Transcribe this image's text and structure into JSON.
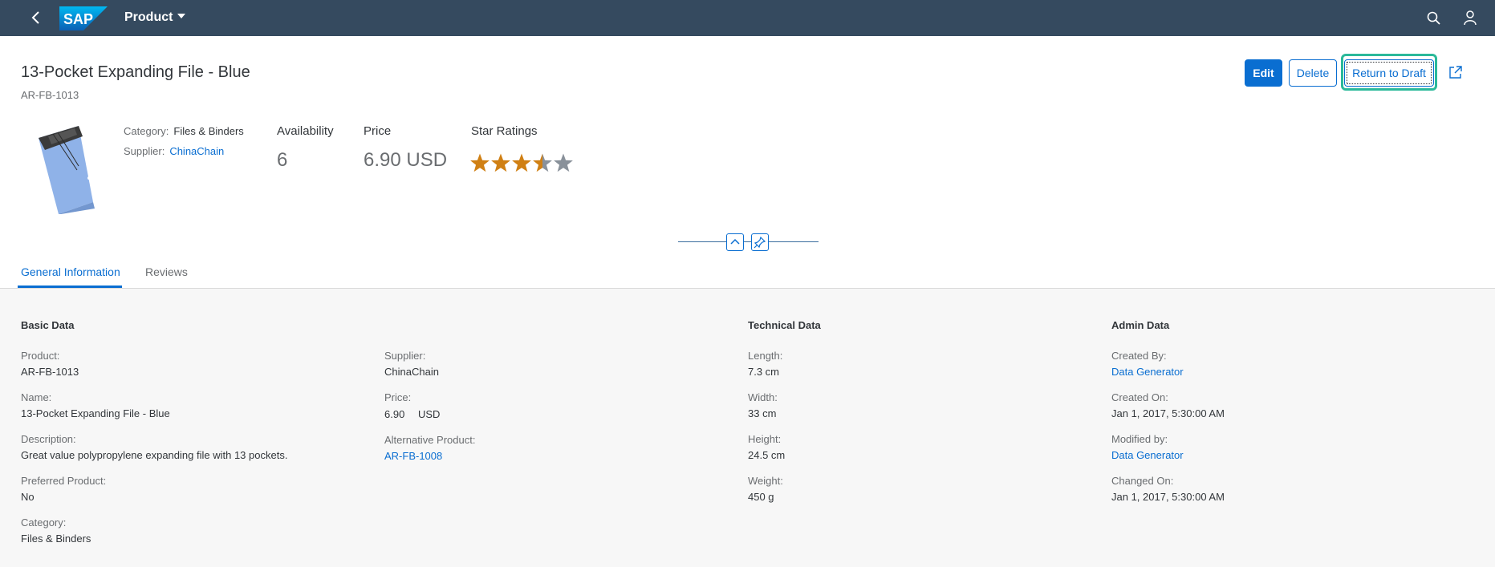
{
  "shell": {
    "app_title": "Product",
    "logo_text": "SAP",
    "colors": {
      "shell_bg": "#354a5f",
      "accent": "#0a6ed1",
      "highlight": "#2bb99a"
    }
  },
  "header": {
    "title": "13-Pocket Expanding File - Blue",
    "subtitle": "AR-FB-1013",
    "actions": {
      "edit": "Edit",
      "delete": "Delete",
      "return_to_draft": "Return to Draft"
    },
    "category_label": "Category:",
    "category_value": "Files & Binders",
    "supplier_label": "Supplier:",
    "supplier_value": "ChinaChain",
    "availability_label": "Availability",
    "availability_value": "6",
    "price_label": "Price",
    "price_value": "6.90 USD",
    "ratings_label": "Star Ratings",
    "rating": 3.5,
    "rating_max": 5
  },
  "tabs": [
    "General Information",
    "Reviews"
  ],
  "basic_data": {
    "title": "Basic Data",
    "product_label": "Product:",
    "product_value": "AR-FB-1013",
    "name_label": "Name:",
    "name_value": "13-Pocket Expanding File - Blue",
    "description_label": "Description:",
    "description_value": "Great value polypropylene expanding file with 13 pockets.",
    "preferred_label": "Preferred Product:",
    "preferred_value": "No",
    "category_label": "Category:",
    "category_value": "Files & Binders",
    "supplier_label": "Supplier:",
    "supplier_value": "ChinaChain",
    "price_label": "Price:",
    "price_amount": "6.90",
    "price_currency": "USD",
    "alt_label": "Alternative Product:",
    "alt_value": "AR-FB-1008"
  },
  "technical_data": {
    "title": "Technical Data",
    "length_label": "Length:",
    "length_value": "7.3 cm",
    "width_label": "Width:",
    "width_value": "33 cm",
    "height_label": "Height:",
    "height_value": "24.5 cm",
    "weight_label": "Weight:",
    "weight_value": "450 g"
  },
  "admin_data": {
    "title": "Admin Data",
    "created_by_label": "Created By:",
    "created_by_value": "Data Generator",
    "created_on_label": "Created On:",
    "created_on_value": "Jan 1, 2017, 5:30:00 AM",
    "modified_by_label": "Modified by:",
    "modified_by_value": "Data Generator",
    "changed_on_label": "Changed On:",
    "changed_on_value": "Jan 1, 2017, 5:30:00 AM"
  },
  "icons": [
    "back-icon",
    "search-icon",
    "user-icon",
    "share-icon",
    "collapse-icon",
    "pin-icon",
    "star-icon"
  ]
}
